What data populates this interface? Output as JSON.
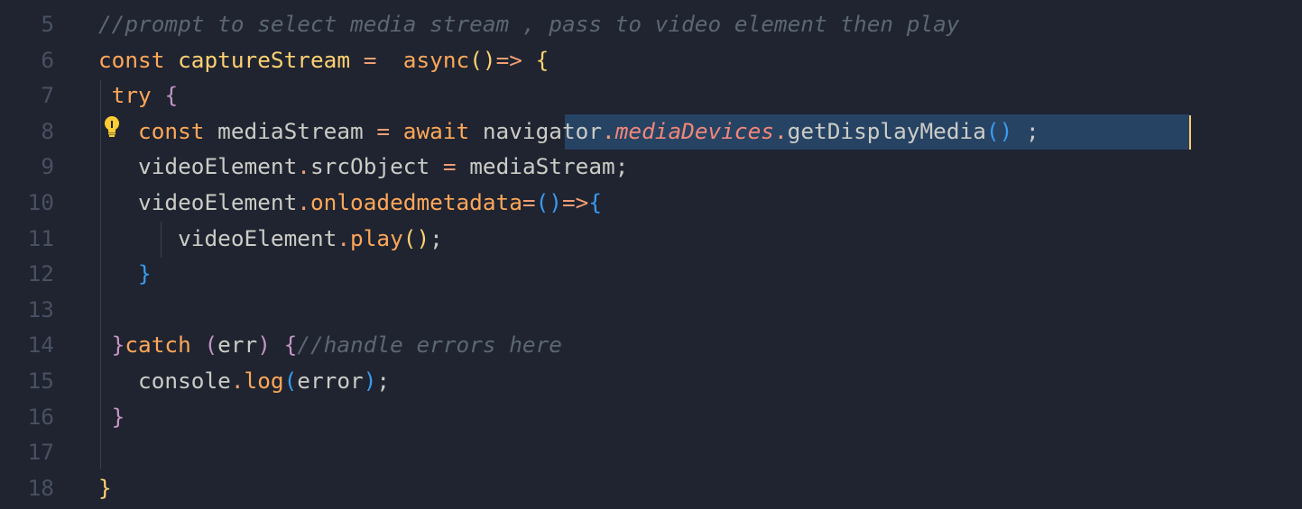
{
  "editor": {
    "lines": [
      {
        "number": "5",
        "tokens": [
          {
            "text": "//prompt to select media stream , pass to video element then play",
            "style": "cmt"
          }
        ]
      },
      {
        "number": "6",
        "tokens": [
          {
            "text": "const ",
            "style": "kw"
          },
          {
            "text": "captureStream",
            "style": "fn"
          },
          {
            "text": " = ",
            "style": "op"
          },
          {
            "text": " async",
            "style": "kw"
          },
          {
            "text": "()",
            "style": "b1"
          },
          {
            "text": "=>",
            "style": "op"
          },
          {
            "text": " {",
            "style": "b1"
          }
        ]
      },
      {
        "number": "7",
        "tokens": [
          {
            "text": " try ",
            "style": "kw"
          },
          {
            "text": "{",
            "style": "b2"
          }
        ]
      },
      {
        "number": "8",
        "tokens": [
          {
            "text": "   const ",
            "style": "kw"
          },
          {
            "text": "mediaStream",
            "style": "var"
          },
          {
            "text": " = ",
            "style": "op"
          },
          {
            "text": "await ",
            "style": "kw"
          },
          {
            "text": "navigator",
            "style": "var"
          },
          {
            "text": ".",
            "style": "op"
          },
          {
            "text": "mediaDevices",
            "style": "prop"
          },
          {
            "text": ".",
            "style": "op"
          },
          {
            "text": "getDisplayMedia",
            "style": "var"
          },
          {
            "text": "()",
            "style": "b3"
          },
          {
            "text": " ;",
            "style": "var"
          }
        ]
      },
      {
        "number": "9",
        "tokens": [
          {
            "text": "   videoElement",
            "style": "var"
          },
          {
            "text": ".",
            "style": "op"
          },
          {
            "text": "srcObject",
            "style": "var"
          },
          {
            "text": " = ",
            "style": "op"
          },
          {
            "text": "mediaStream;",
            "style": "var"
          }
        ]
      },
      {
        "number": "10",
        "tokens": [
          {
            "text": "   videoElement",
            "style": "var"
          },
          {
            "text": ".",
            "style": "op"
          },
          {
            "text": "onloadedmetadata",
            "style": "meth"
          },
          {
            "text": "=",
            "style": "op"
          },
          {
            "text": "()",
            "style": "b3"
          },
          {
            "text": "=>",
            "style": "op"
          },
          {
            "text": "{",
            "style": "b3"
          }
        ]
      },
      {
        "number": "11",
        "tokens": [
          {
            "text": "      videoElement",
            "style": "var"
          },
          {
            "text": ".",
            "style": "op"
          },
          {
            "text": "play",
            "style": "meth"
          },
          {
            "text": "()",
            "style": "b1"
          },
          {
            "text": ";",
            "style": "var"
          }
        ]
      },
      {
        "number": "12",
        "tokens": [
          {
            "text": "   }",
            "style": "b3"
          }
        ]
      },
      {
        "number": "13",
        "tokens": []
      },
      {
        "number": "14",
        "tokens": [
          {
            "text": " }",
            "style": "b2"
          },
          {
            "text": "catch ",
            "style": "kw"
          },
          {
            "text": "(",
            "style": "b2"
          },
          {
            "text": "err",
            "style": "var"
          },
          {
            "text": ") ",
            "style": "b2"
          },
          {
            "text": "{",
            "style": "b2"
          },
          {
            "text": "//handle errors here",
            "style": "cmt"
          }
        ]
      },
      {
        "number": "15",
        "tokens": [
          {
            "text": "   console",
            "style": "var"
          },
          {
            "text": ".",
            "style": "op"
          },
          {
            "text": "log",
            "style": "meth"
          },
          {
            "text": "(",
            "style": "b3"
          },
          {
            "text": "error",
            "style": "var"
          },
          {
            "text": ")",
            "style": "b3"
          },
          {
            "text": ";",
            "style": "var"
          }
        ]
      },
      {
        "number": "16",
        "tokens": [
          {
            "text": " }",
            "style": "b2"
          }
        ]
      },
      {
        "number": "17",
        "tokens": []
      },
      {
        "number": "18",
        "tokens": [
          {
            "text": "}",
            "style": "b1"
          }
        ]
      }
    ],
    "lightbulb_icon": "lightbulb-icon",
    "colors": {
      "background": "#1f2430",
      "selection": "#274364",
      "caret": "#ffcc66",
      "line_number": "#495062"
    }
  }
}
